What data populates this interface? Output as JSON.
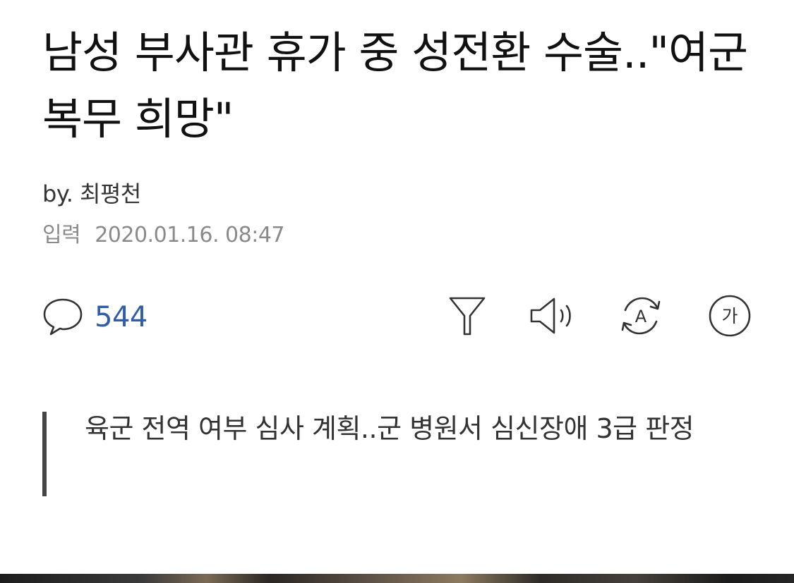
{
  "article": {
    "title": "남성 부사관 휴가 중 성전환 수술..\"여군 복무 희망\"",
    "byline": "by. 최평천",
    "date_label": "입력",
    "date_value": "2020.01.16. 08:47",
    "subheadline": "육군 전역 여부 심사 계획..군 병원서 심신장애 3급 판정"
  },
  "toolbar": {
    "comment_count": "544",
    "filter_icon": "filter-icon",
    "tts_icon": "speaker-icon",
    "translate_icon": "translate-icon",
    "font_size_icon": "font-size-icon",
    "font_size_glyph": "가",
    "translate_glyph": "A",
    "accent_color": "#2f5da8"
  },
  "colors": {
    "text": "#111111",
    "meta": "#8a8a8a",
    "quote_bar": "#444444"
  }
}
